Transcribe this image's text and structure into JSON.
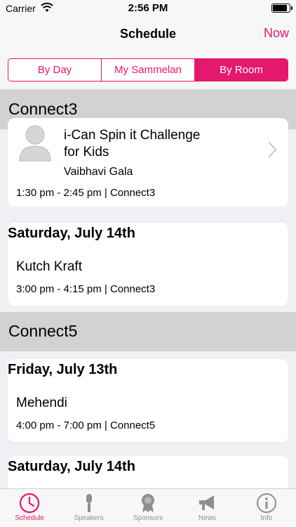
{
  "status_bar": {
    "carrier": "Carrier",
    "time": "2:56 PM"
  },
  "nav": {
    "title": "Schedule",
    "now_label": "Now"
  },
  "segments": [
    {
      "label": "By Day",
      "active": false
    },
    {
      "label": "My Sammelan",
      "active": false
    },
    {
      "label": "By Room",
      "active": true
    }
  ],
  "rooms": [
    {
      "name": "Connect3",
      "cards": [
        {
          "title_line1": "i-Can Spin it Challenge",
          "title_line2": "for Kids",
          "speaker": "Vaibhavi Gala",
          "time": "1:30 pm - 2:45 pm | Connect3"
        },
        {
          "day": "Saturday, July 14th",
          "title": "Kutch Kraft",
          "time": "3:00 pm - 4:15 pm | Connect3"
        }
      ]
    },
    {
      "name": "Connect5",
      "cards": [
        {
          "day": "Friday, July 13th",
          "title": "Mehendi",
          "time": "4:00 pm - 7:00 pm | Connect5"
        },
        {
          "day": "Saturday, July 14th"
        }
      ]
    }
  ],
  "tabs": [
    {
      "label": "Schedule",
      "icon": "clock-icon",
      "active": true
    },
    {
      "label": "Speakers",
      "icon": "microphone-icon",
      "active": false
    },
    {
      "label": "Sponsors",
      "icon": "award-ribbon-icon",
      "active": false
    },
    {
      "label": "News",
      "icon": "megaphone-icon",
      "active": false
    },
    {
      "label": "Info",
      "icon": "info-icon",
      "active": false
    }
  ],
  "colors": {
    "accent": "#e5186f",
    "inactive": "#8e8e93",
    "room_header": "#d2d2d2",
    "background": "#f0eff4"
  }
}
